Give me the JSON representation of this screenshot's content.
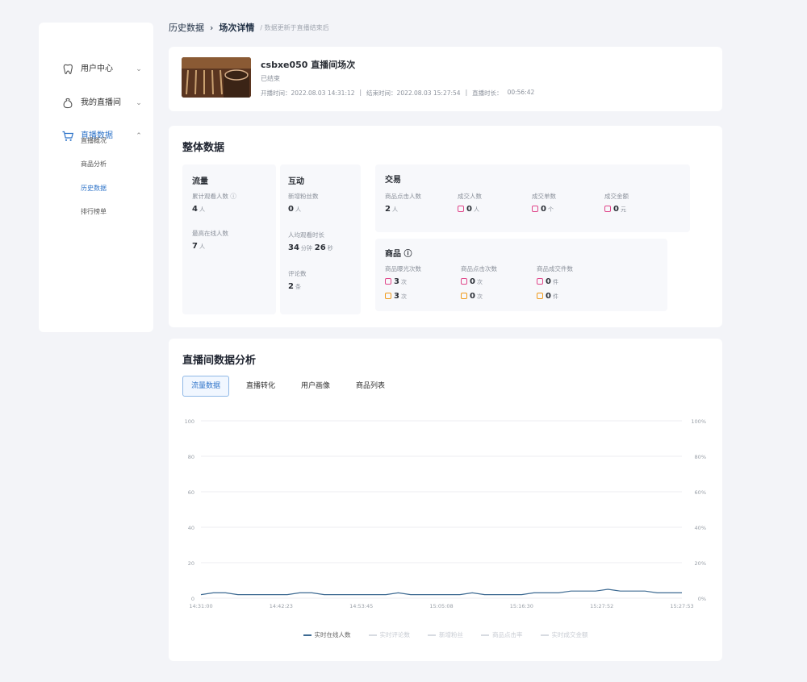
{
  "sidebar": {
    "groups": [
      {
        "label": "用户中心",
        "icon": "tooth-icon"
      },
      {
        "label": "我的直播间",
        "icon": "bag-icon"
      },
      {
        "label": "直播数据",
        "icon": "cart-icon"
      }
    ],
    "sub_items": [
      "直播概况",
      "商品分析",
      "历史数据",
      "排行榜单"
    ]
  },
  "breadcrumb": {
    "root": "历史数据",
    "separator": "›",
    "current": "场次详情",
    "note": "/ 数据更新于直播结束后"
  },
  "session": {
    "title": "csbxe050 直播间场次",
    "subtitle": "已结束",
    "meta": [
      "开播时间：2022.08.03 14:31:12",
      "|",
      "结束时间：2022.08.03 15:27:54",
      "|",
      "直播时长：",
      "00:56:42"
    ]
  },
  "overview": {
    "title": "整体数据",
    "flow": {
      "title": "流量",
      "metrics": [
        {
          "label": "累计观看人数 ⓘ",
          "value": "4",
          "unit": "人"
        },
        {
          "label": "最高在线人数",
          "value": "7",
          "unit": "人"
        }
      ]
    },
    "interact": {
      "title": "互动",
      "metrics": [
        {
          "label": "新增粉丝数",
          "value": "0",
          "unit": "人"
        },
        {
          "label": "人均观看时长",
          "value": "34",
          "unit": "分钟",
          "value2": "26",
          "unit2": "秒"
        },
        {
          "label": "评论数",
          "value": "2",
          "unit": "条"
        }
      ]
    },
    "trade": {
      "title": "交易",
      "metrics": [
        {
          "label": "商品点击人数",
          "value": "2",
          "unit": "人"
        },
        {
          "label": "成交人数",
          "value": "0",
          "unit": "人"
        },
        {
          "label": "成交单数",
          "value": "0",
          "unit": "个"
        },
        {
          "label": "成交金额",
          "value": "0",
          "unit": "元"
        }
      ]
    },
    "goods": {
      "title": "商品 ⓘ",
      "columns": [
        "商品曝光次数",
        "商品点击次数",
        "商品成交件数"
      ],
      "row_pink": [
        {
          "value": "3",
          "unit": "次"
        },
        {
          "value": "0",
          "unit": "次"
        },
        {
          "value": "0",
          "unit": "件"
        }
      ],
      "row_orange": [
        {
          "value": "3",
          "unit": "次"
        },
        {
          "value": "0",
          "unit": "次"
        },
        {
          "value": "0",
          "unit": "件"
        }
      ]
    }
  },
  "analysis": {
    "title": "直播间数据分析",
    "tabs": [
      "流量数据",
      "直播转化",
      "用户画像",
      "商品列表"
    ],
    "active_tab": 0
  },
  "chart_data": {
    "type": "line",
    "x_ticks": [
      "14:31:00",
      "14:42:23",
      "14:53:45",
      "15:05:08",
      "15:16:30",
      "15:27:52",
      "15:27:53"
    ],
    "y_left_ticks": [
      "0",
      "20",
      "40",
      "60",
      "80",
      "100"
    ],
    "y_left_range": [
      0,
      100
    ],
    "y_right_ticks": [
      "0%",
      "20%",
      "40%",
      "60%",
      "80%",
      "100%"
    ],
    "y_right_range": [
      0,
      100
    ],
    "grid": true,
    "legend_position": "bottom",
    "series": [
      {
        "name": "实时在线人数",
        "color": "#3d6a92",
        "values": [
          2,
          3,
          3,
          2,
          2,
          2,
          2,
          2,
          3,
          3,
          2,
          2,
          2,
          2,
          2,
          2,
          3,
          2,
          2,
          2,
          2,
          2,
          3,
          2,
          2,
          2,
          2,
          3,
          3,
          3,
          4,
          4,
          4,
          5,
          4,
          4,
          4,
          3,
          3,
          3
        ]
      }
    ],
    "legend": [
      {
        "label": "实时在线人数",
        "enabled": true
      },
      {
        "label": "实时评论数",
        "enabled": false
      },
      {
        "label": "新增粉丝",
        "enabled": false
      },
      {
        "label": "商品点击率",
        "enabled": false
      },
      {
        "label": "实时成交金额",
        "enabled": false
      }
    ]
  }
}
